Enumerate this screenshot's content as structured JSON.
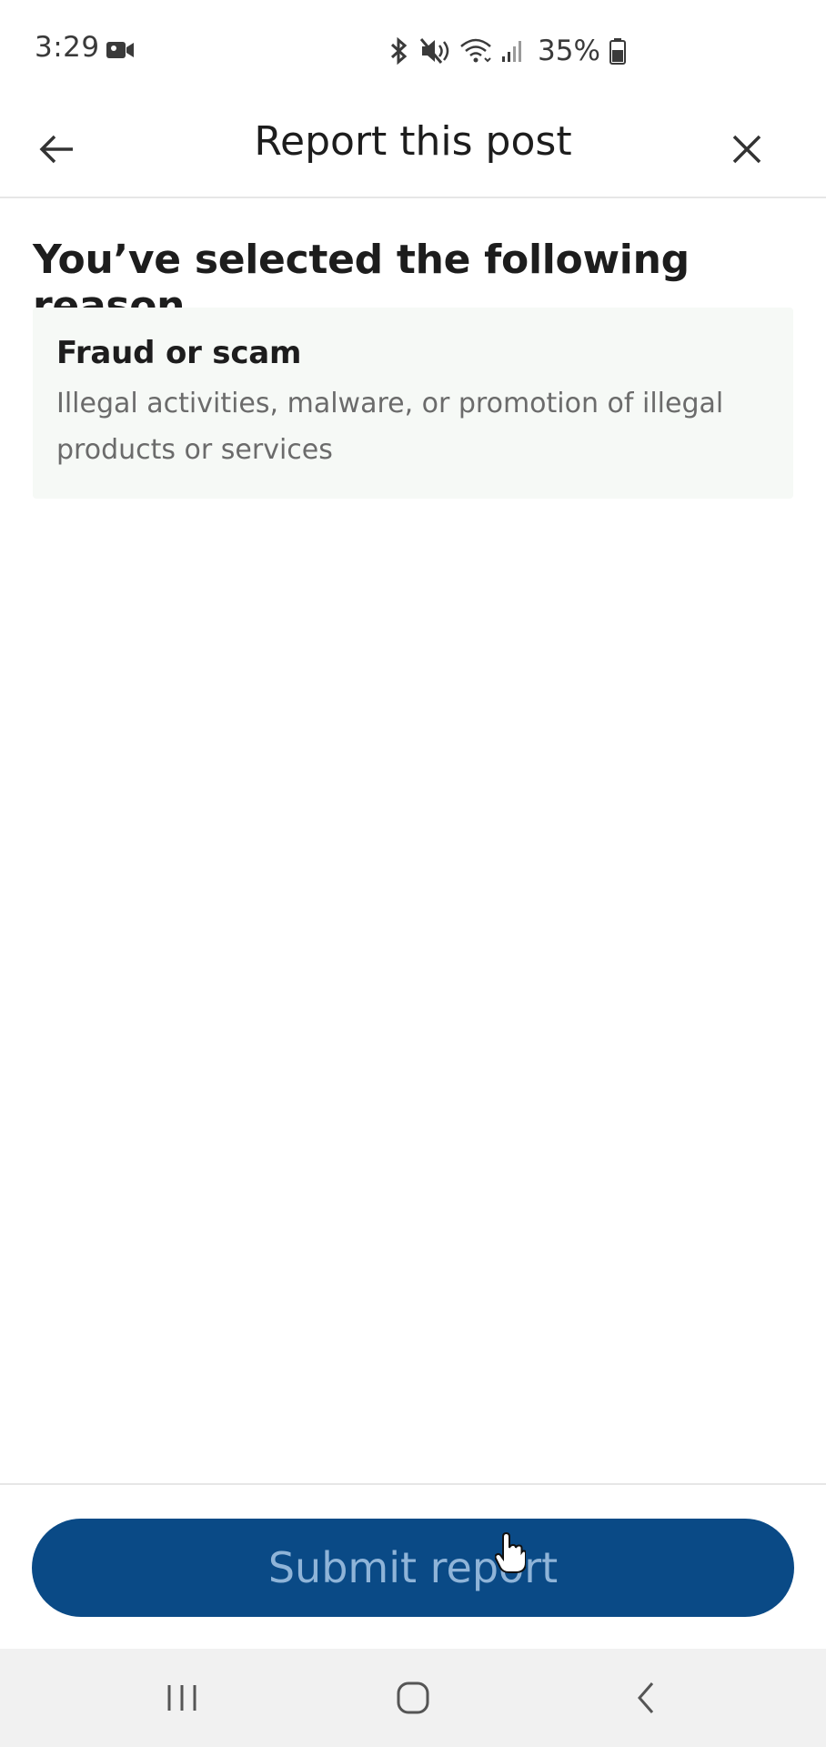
{
  "status_bar": {
    "time": "3:29",
    "battery_percent": "35%",
    "icons": [
      "video-camera-icon",
      "bluetooth-icon",
      "mute-icon",
      "wifi-icon",
      "signal-icon",
      "battery-icon"
    ]
  },
  "app_bar": {
    "title": "Report this post",
    "back_icon": "arrow-left-icon",
    "close_icon": "close-icon"
  },
  "content": {
    "heading": "You’ve selected the following reason",
    "reason": {
      "title": "Fraud or scam",
      "description": "Illegal activities, malware, or promotion of illegal products or services"
    }
  },
  "actions": {
    "submit_label": "Submit report"
  },
  "nav_bar": {
    "icons": [
      "recent-apps-icon",
      "home-icon",
      "back-icon"
    ]
  },
  "colors": {
    "primary": "#0a4a86",
    "primary_text_disabled": "#8fb4d8",
    "card_bg": "#f6f9f6",
    "text_primary": "#1d1d1d",
    "text_secondary": "#6b6b6b",
    "nav_bg": "#f1f1f1"
  }
}
